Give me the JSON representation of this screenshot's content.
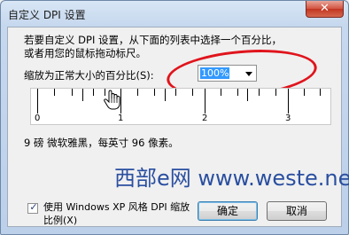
{
  "window": {
    "title": "自定义 DPI 设置",
    "close_glyph": "✕"
  },
  "dialog": {
    "intro_line1": "若要自定义 DPI 设置，从下面的列表中选择一个百分比，",
    "intro_line2": "或者用您的鼠标拖动标尺。",
    "scale_label": "缩放为正常大小的百分比(S):",
    "scale_value": "100%",
    "ruler_numbers": [
      "0",
      "1",
      "2",
      "3"
    ],
    "font_info": "9 磅 微软雅黑，每英寸 96 像素。",
    "xp_checkbox_label": "使用 Windows XP 风格 DPI 缩放比例(X)",
    "xp_checkbox_checked": true,
    "ok_label": "确定",
    "cancel_label": "取消"
  },
  "watermark": "西部e网 www.weste.net",
  "icons": {
    "pointer": "hand-cursor-icon",
    "dropdown": "chevron-down-icon",
    "checkmark": "checkmark-icon",
    "close": "close-icon"
  },
  "colors": {
    "highlight_ring": "#e0141c",
    "selection": "#3399ff",
    "watermark": "#2a4fa0"
  }
}
